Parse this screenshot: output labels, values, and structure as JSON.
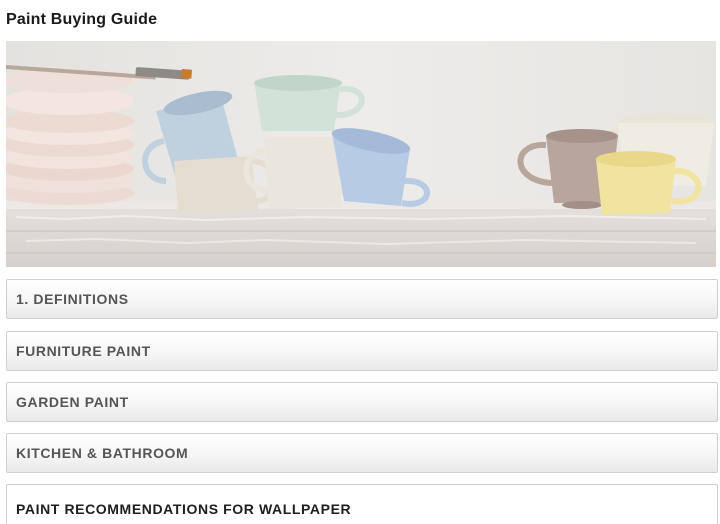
{
  "page": {
    "title": "Paint Buying Guide"
  },
  "hero": {
    "image_alt": "cups and plates on shelf"
  },
  "accordion": {
    "items": [
      {
        "label": "1. DEFINITIONS",
        "active": false
      },
      {
        "label": "FURNITURE PAINT",
        "active": false
      },
      {
        "label": "GARDEN PAINT",
        "active": false
      },
      {
        "label": "KITCHEN & BATHROOM",
        "active": false
      },
      {
        "label": "PAINT RECOMMENDATIONS FOR WALLPAPER",
        "active": true
      }
    ]
  },
  "colors": {
    "text_dark": "#1a1a1a",
    "text_muted": "#555555",
    "border": "#cfcfcf"
  }
}
